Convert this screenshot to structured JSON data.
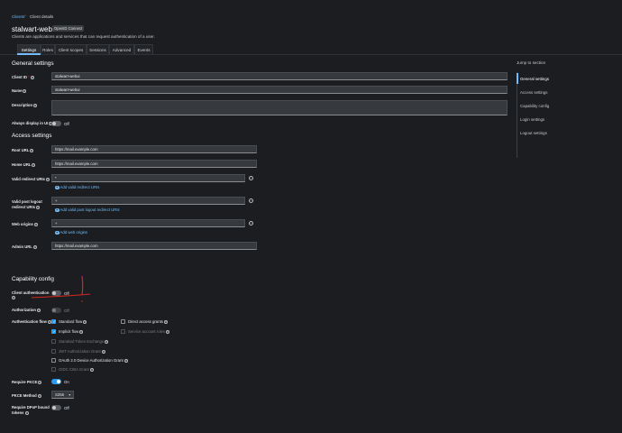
{
  "breadcrumb": {
    "root": "Clients",
    "current": "Client details"
  },
  "page": {
    "title": "stalwart-webui",
    "badge": "OpenID Connect",
    "subtitle": "Clients are applications and services that can request authentication of a user."
  },
  "tabs": [
    "Settings",
    "Roles",
    "Client scopes",
    "Sessions",
    "Advanced",
    "Events"
  ],
  "general": {
    "title": "General settings",
    "client_id_label": "Client ID",
    "client_id_value": "stalwart-webui",
    "name_label": "Name",
    "name_value": "stalwart-webui",
    "description_label": "Description",
    "description_value": "",
    "always_display_label": "Always display in UI",
    "always_display_state": "Off"
  },
  "access": {
    "title": "Access settings",
    "root_url_label": "Root URL",
    "root_url_value": "https://mail.example.com",
    "home_url_label": "Home URL",
    "home_url_value": "https://mail.example.com",
    "valid_redirect_label": "Valid redirect URIs",
    "valid_redirect_value": "*",
    "valid_redirect_add": "Add valid redirect URIs",
    "post_logout_label_1": "Valid post logout",
    "post_logout_label_2": "redirect URIs",
    "post_logout_value": "+",
    "post_logout_add": "Add valid post logout redirect URIs",
    "web_origins_label": "Web origins",
    "web_origins_value": "+",
    "web_origins_add": "Add web origins",
    "admin_url_label": "Admin URL",
    "admin_url_value": "https://mail.example.com"
  },
  "capability": {
    "title": "Capability config",
    "client_auth_label": "Client authentication",
    "client_auth_state": "Off",
    "authorization_label": "Authorization",
    "authorization_state": "Off",
    "auth_flow_label": "Authentication flow",
    "flows": {
      "standard": "Standard flow",
      "direct": "Direct access grants",
      "implicit": "Implicit flow",
      "service": "Service account roles",
      "token_exchange": "Standard Token Exchange",
      "jwt": "JWT Authorization Grant",
      "oauth_device": "OAuth 2.0 Device Authorization Grant",
      "ciba": "OIDC CIBA Grant"
    },
    "pkce_label": "Require PKCE",
    "pkce_state": "On",
    "pkce_method_label": "PKCE Method",
    "pkce_method_value": "S256",
    "dpop_label_1": "Require DPoP bound",
    "dpop_label_2": "tokens",
    "dpop_state": "Off"
  },
  "jump": {
    "title": "Jump to section",
    "items": [
      "General settings",
      "Access settings",
      "Capability config",
      "Login settings",
      "Logout settings"
    ]
  },
  "icons": {
    "help": "?",
    "minus": "−",
    "plus": "+",
    "caret": "▼",
    "chevron": "›"
  },
  "colors": {
    "accent": "#73bcf7",
    "switch_on": "#2b9af3",
    "annotation": "#d9261c"
  }
}
